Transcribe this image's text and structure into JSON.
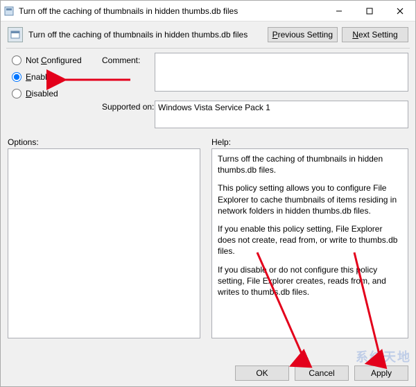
{
  "window": {
    "title": "Turn off the caching of thumbnails in hidden thumbs.db files"
  },
  "header": {
    "title": "Turn off the caching of thumbnails in hidden thumbs.db files",
    "prev": "Previous Setting",
    "next": "Next Setting"
  },
  "radios": {
    "not_configured": "Not Configured",
    "enabled": "Enabled",
    "disabled": "Disabled",
    "selected": "enabled"
  },
  "labels": {
    "comment": "Comment:",
    "supported": "Supported on:",
    "options": "Options:",
    "help": "Help:"
  },
  "fields": {
    "comment": "",
    "supported": "Windows Vista Service Pack 1"
  },
  "help": {
    "p1": "Turns off the caching of thumbnails in hidden thumbs.db files.",
    "p2": "This policy setting allows you to configure File Explorer to cache thumbnails of items residing in network folders in hidden thumbs.db files.",
    "p3": "If you enable this policy setting, File Explorer does not create, read from, or write to thumbs.db files.",
    "p4": "If you disable or do not configure this policy setting, File Explorer creates, reads from, and writes to thumbs.db files."
  },
  "footer": {
    "ok": "OK",
    "cancel": "Cancel",
    "apply": "Apply"
  },
  "watermark": "系统天地"
}
